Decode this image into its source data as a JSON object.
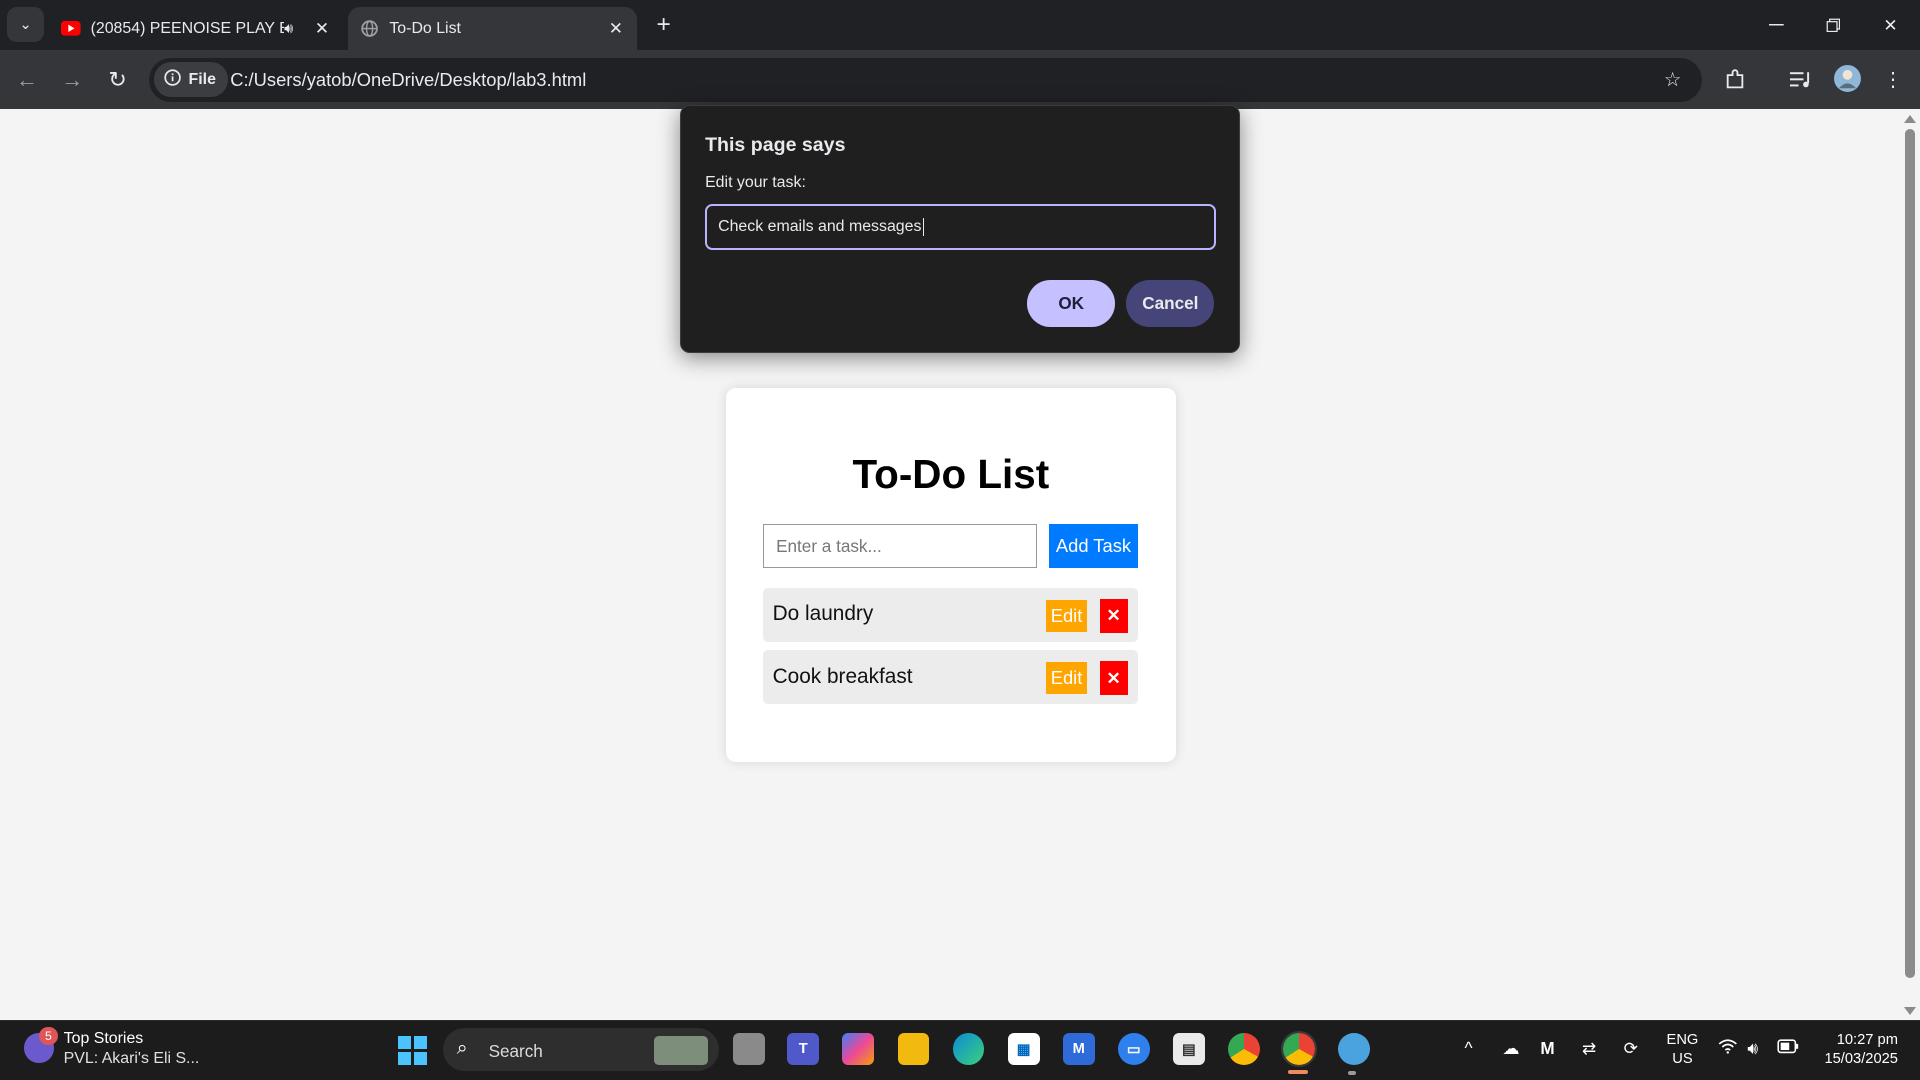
{
  "browser": {
    "tabs": [
      {
        "title": "(20854) PEENOISE PLAY BO",
        "active": false,
        "audio": true
      },
      {
        "title": "To-Do List",
        "active": true,
        "audio": false
      }
    ],
    "address_chip": "File",
    "url": "C:/Users/yatob/OneDrive/Desktop/lab3.html"
  },
  "dialog": {
    "title": "This page says",
    "message": "Edit your task:",
    "value": "Check emails and messages",
    "ok_label": "OK",
    "cancel_label": "Cancel"
  },
  "app": {
    "heading": "To-Do List",
    "input_placeholder": "Enter a task...",
    "add_label": "Add Task",
    "tasks": [
      {
        "text": "Do laundry",
        "edit_label": "Edit",
        "delete_label": "✕"
      },
      {
        "text": "Cook breakfast",
        "edit_label": "Edit",
        "delete_label": "✕"
      }
    ],
    "colors": {
      "add": "#007bff",
      "edit": "#ffa500",
      "delete": "#ff0000"
    }
  },
  "taskbar": {
    "news_badge": "5",
    "news_title": "Top Stories",
    "news_subtitle": "PVL: Akari's Eli S...",
    "search_label": "Search",
    "lang_line1": "ENG",
    "lang_line2": "US",
    "time": "10:27 pm",
    "date": "15/03/2025"
  }
}
